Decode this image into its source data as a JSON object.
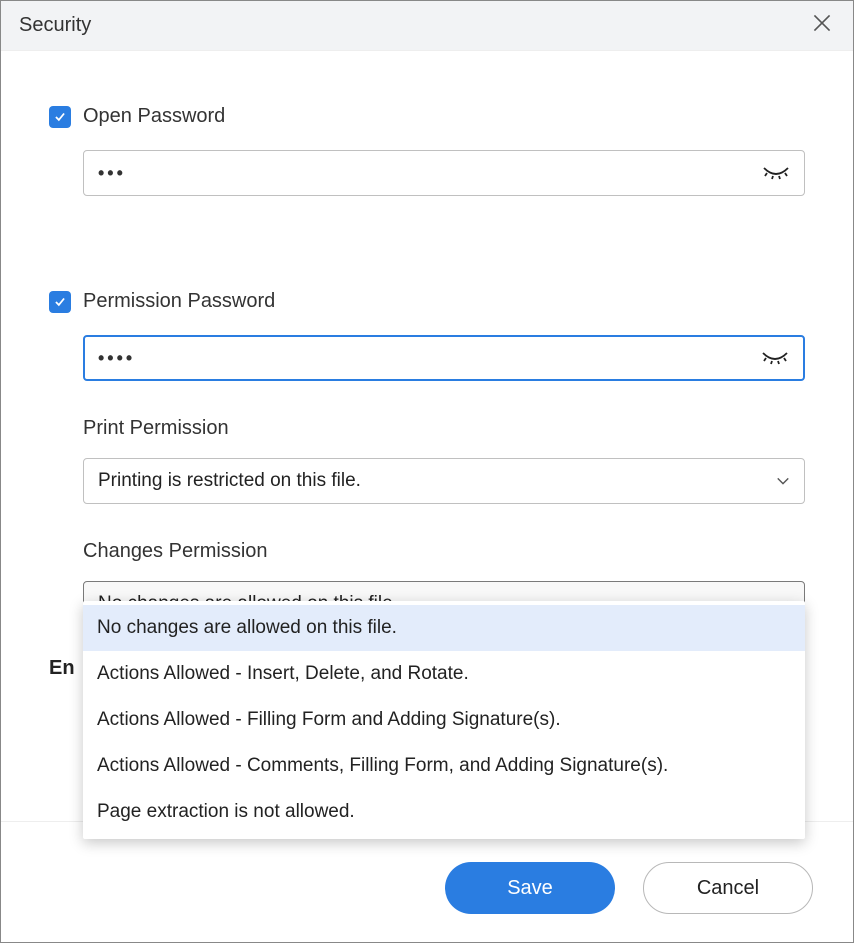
{
  "dialog": {
    "title": "Security"
  },
  "openPassword": {
    "label": "Open Password",
    "value": "•••"
  },
  "permissionPassword": {
    "label": "Permission Password",
    "value": "••••"
  },
  "printPermission": {
    "label": "Print Permission",
    "selected": "Printing is restricted on this file."
  },
  "changesPermission": {
    "label": "Changes Permission",
    "selected": "No changes are allowed on this file.",
    "options": [
      "No changes are allowed on this file.",
      "Actions Allowed - Insert, Delete, and Rotate.",
      "Actions Allowed - Filling Form and Adding Signature(s).",
      "Actions Allowed - Comments, Filling Form, and Adding Signature(s).",
      "Page extraction is not allowed."
    ]
  },
  "encryption": {
    "labelVisible": "En"
  },
  "buttons": {
    "save": "Save",
    "cancel": "Cancel"
  }
}
